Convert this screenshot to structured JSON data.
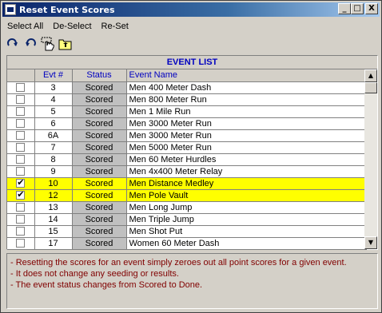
{
  "window": {
    "title": "Reset Event Scores",
    "buttons": [
      "_",
      "□",
      "X"
    ]
  },
  "menu": [
    "Select All",
    "De-Select",
    "Re-Set"
  ],
  "toolbar": {
    "icons": [
      "redo-icon",
      "undo-icon",
      "hand-cursor-icon",
      "folder-up-icon"
    ]
  },
  "grid": {
    "caption": "EVENT LIST",
    "headers": [
      "",
      "Evt #",
      "Status",
      "Event Name"
    ],
    "rows": [
      {
        "checked": false,
        "evt": "3",
        "status": "Scored",
        "name": "Men 400 Meter Dash"
      },
      {
        "checked": false,
        "evt": "4",
        "status": "Scored",
        "name": "Men 800 Meter Run"
      },
      {
        "checked": false,
        "evt": "5",
        "status": "Scored",
        "name": "Men 1 Mile Run"
      },
      {
        "checked": false,
        "evt": "6",
        "status": "Scored",
        "name": "Men 3000 Meter Run"
      },
      {
        "checked": false,
        "evt": "6A",
        "status": "Scored",
        "name": "Men 3000 Meter Run"
      },
      {
        "checked": false,
        "evt": "7",
        "status": "Scored",
        "name": "Men 5000 Meter Run"
      },
      {
        "checked": false,
        "evt": "8",
        "status": "Scored",
        "name": "Men 60 Meter Hurdles"
      },
      {
        "checked": false,
        "evt": "9",
        "status": "Scored",
        "name": "Men 4x400 Meter Relay"
      },
      {
        "checked": true,
        "evt": "10",
        "status": "Scored",
        "name": "Men Distance Medley"
      },
      {
        "checked": true,
        "evt": "12",
        "status": "Scored",
        "name": "Men Pole Vault"
      },
      {
        "checked": false,
        "evt": "13",
        "status": "Scored",
        "name": "Men Long Jump"
      },
      {
        "checked": false,
        "evt": "14",
        "status": "Scored",
        "name": "Men Triple Jump"
      },
      {
        "checked": false,
        "evt": "15",
        "status": "Scored",
        "name": "Men Shot Put"
      },
      {
        "checked": false,
        "evt": "17",
        "status": "Scored",
        "name": "Women 60 Meter Dash"
      }
    ]
  },
  "notes": [
    "- Resetting the scores for an event simply zeroes out all point scores for a given event.",
    "- It does not change any seeding or results.",
    "- The event status changes from Scored to Done."
  ],
  "colors": {
    "title_bar": "#0a246a",
    "selected_row": "#ffff00",
    "header_text": "#0000c0",
    "notes_text": "#800000"
  }
}
